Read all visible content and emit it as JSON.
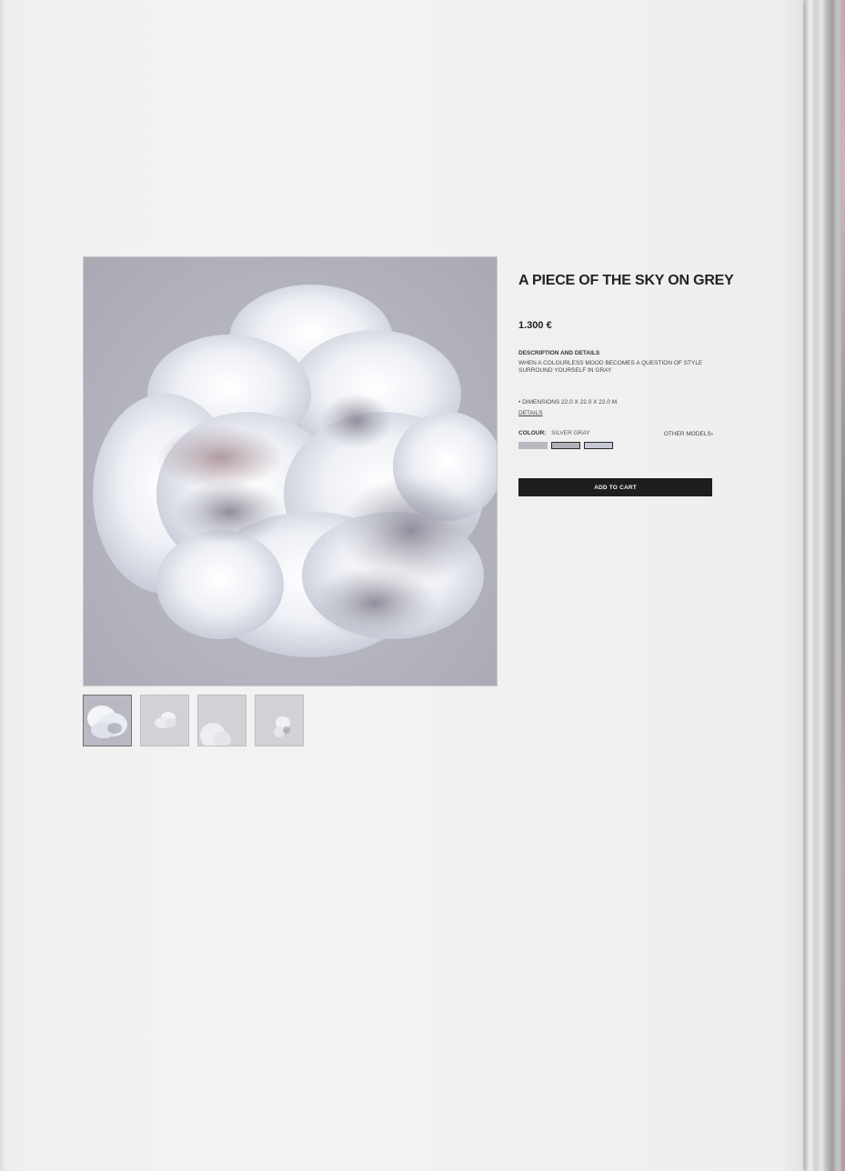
{
  "product": {
    "title": "A PIECE OF THE SKY ON GREY",
    "price": "1.300 €",
    "description_heading": "DESCRIPTION AND DETAILS",
    "description_lines": [
      "WHEN A COLOURLESS MOOD BECOMES A QUESTION OF STYLE",
      "SURROUND YOURSELF IN GRAY"
    ],
    "dimensions": "• DIMENSIONS  22.0 X 22.0 X 22.0 M",
    "details_link": "DETAILS",
    "colour_label": "COLOUR:",
    "colour_value": "SILVER GRAY",
    "other_models": "OTHER MODELS›",
    "add_to_cart": "ADD TO CART"
  },
  "swatches": [
    {
      "name": "silver-gray",
      "color": "#b9b9c2",
      "selected": true
    },
    {
      "name": "gray",
      "color": "#b1b1b9",
      "selected": false
    },
    {
      "name": "blue-gray",
      "color": "#c4c8d8",
      "selected": false
    }
  ],
  "gallery": {
    "thumbnail_count": 4,
    "active_index": 0
  },
  "colors": {
    "page": "#f1f1f1",
    "button": "#1e1e1e",
    "image_bg": "#b3b3be"
  }
}
